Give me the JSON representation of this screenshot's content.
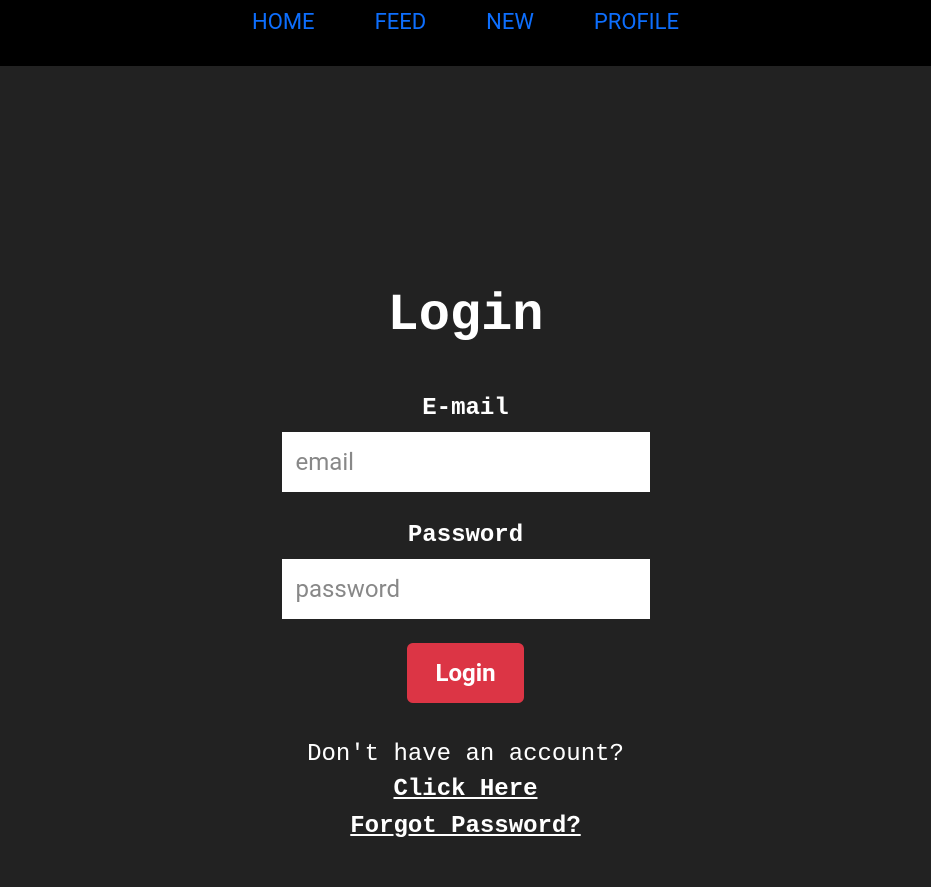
{
  "nav": {
    "home": "HOME",
    "feed": "FEED",
    "new": "NEW",
    "profile": "PROFILE"
  },
  "login": {
    "title": "Login",
    "email_label": "E-mail",
    "email_placeholder": "email",
    "password_label": "Password",
    "password_placeholder": "password",
    "button_label": "Login",
    "no_account_text": "Don't have an account?",
    "signup_link": "Click Here",
    "forgot_password_link": "Forgot Password?"
  }
}
